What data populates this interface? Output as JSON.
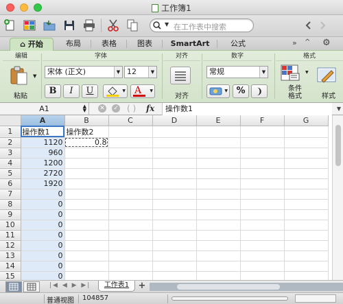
{
  "window": {
    "title": "工作簿1"
  },
  "toolbar": {
    "search_placeholder": "在工作表中搜索",
    "icons": [
      "new-icon",
      "template-icon",
      "open-icon",
      "save-icon",
      "print-icon",
      "cut-icon",
      "copy-icon",
      "search-icon",
      "back-icon",
      "forward-icon"
    ]
  },
  "tabs": [
    {
      "label": "开始",
      "active": true
    },
    {
      "label": "布局",
      "active": false
    },
    {
      "label": "表格",
      "active": false
    },
    {
      "label": "图表",
      "active": false
    },
    {
      "label": "SmartArt",
      "active": false
    },
    {
      "label": "公式",
      "active": false
    }
  ],
  "ribbon": {
    "group_edit": "编辑",
    "group_font": "字体",
    "group_align": "对齐",
    "group_number": "数字",
    "group_format": "格式",
    "paste_label": "粘贴",
    "font_name": "宋体 (正文)",
    "font_size": "12",
    "bold": "B",
    "italic": "I",
    "underline": "U",
    "font_color_letter": "A",
    "align_label": "对齐",
    "number_format": "常规",
    "percent": "%",
    "comma": "❩",
    "cond_format_line1": "条件",
    "cond_format_line2": "格式",
    "styles_label": "样式",
    "accent_red": "#d00000",
    "accent_yellow": "#f5d000"
  },
  "formula_bar": {
    "name_box": "A1",
    "fx": "fx",
    "content": "操作数1"
  },
  "sheet": {
    "columns": [
      "A",
      "B",
      "C",
      "D",
      "E",
      "F",
      "G"
    ],
    "rows": [
      {
        "n": "1",
        "a": "操作数1",
        "b": "操作数2"
      },
      {
        "n": "2",
        "a": "1120",
        "b": "0.8"
      },
      {
        "n": "3",
        "a": "960",
        "b": ""
      },
      {
        "n": "4",
        "a": "1200",
        "b": ""
      },
      {
        "n": "5",
        "a": "2720",
        "b": ""
      },
      {
        "n": "6",
        "a": "1920",
        "b": ""
      },
      {
        "n": "7",
        "a": "0",
        "b": ""
      },
      {
        "n": "8",
        "a": "0",
        "b": ""
      },
      {
        "n": "9",
        "a": "0",
        "b": ""
      },
      {
        "n": "10",
        "a": "0",
        "b": ""
      },
      {
        "n": "11",
        "a": "0",
        "b": ""
      },
      {
        "n": "12",
        "a": "0",
        "b": ""
      },
      {
        "n": "13",
        "a": "0",
        "b": ""
      },
      {
        "n": "14",
        "a": "0",
        "b": ""
      },
      {
        "n": "15",
        "a": "0",
        "b": ""
      }
    ]
  },
  "sheet_tabs": {
    "active": "工作表1",
    "add": "+"
  },
  "status": {
    "view": "普通视图",
    "count": "104857"
  }
}
